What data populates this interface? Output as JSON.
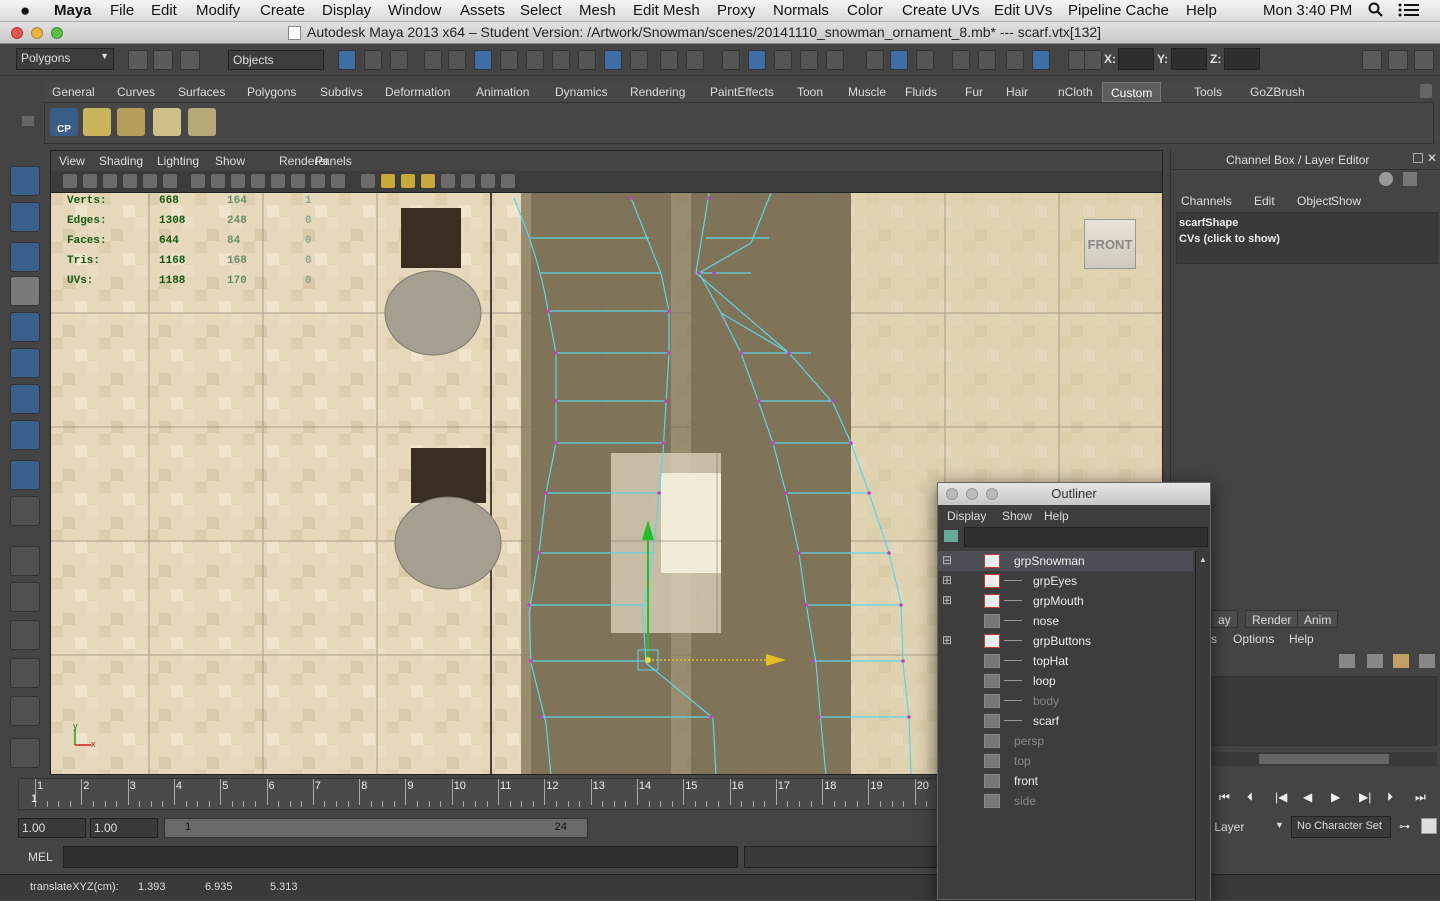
{
  "menubar": {
    "app": "Maya",
    "items": [
      "File",
      "Edit",
      "Modify",
      "Create",
      "Display",
      "Window",
      "Assets",
      "Select",
      "Mesh",
      "Edit Mesh",
      "Proxy",
      "Normals",
      "Color",
      "Create UVs",
      "Edit UVs",
      "Pipeline Cache",
      "Help"
    ],
    "clock": "Mon 3:40 PM"
  },
  "window": {
    "title": "Autodesk Maya 2013 x64 – Student Version: /Artwork/Snowman/scenes/20141110_snowman_ornament_8.mb*   ---   scarf.vtx[132]"
  },
  "statusline": {
    "mode": "Polygons",
    "selection_mode": "Objects",
    "x_label": "X:",
    "y_label": "Y:",
    "z_label": "Z:"
  },
  "shelf_tabs": [
    "General",
    "Curves",
    "Surfaces",
    "Polygons",
    "Subdivs",
    "Deformation",
    "Animation",
    "Dynamics",
    "Rendering",
    "PaintEffects",
    "Toon",
    "Muscle",
    "Fluids",
    "Fur",
    "Hair",
    "nCloth",
    "Custom",
    "Tools",
    "GoZBrush"
  ],
  "active_shelf_tab": "Custom",
  "shelf_icon_label": "CP",
  "viewport": {
    "menu": [
      "View",
      "Shading",
      "Lighting",
      "Show",
      "Renderer",
      "Panels"
    ],
    "camera_label": "FRONT",
    "hud": [
      {
        "label": "Verts:",
        "a": "668",
        "b": "164",
        "c": "1"
      },
      {
        "label": "Edges:",
        "a": "1308",
        "b": "248",
        "c": "0"
      },
      {
        "label": "Faces:",
        "a": "644",
        "b": "84",
        "c": "0"
      },
      {
        "label": "Tris:",
        "a": "1168",
        "b": "168",
        "c": "0"
      },
      {
        "label": "UVs:",
        "a": "1188",
        "b": "170",
        "c": "0"
      }
    ],
    "axis_y": "y",
    "axis_x": "x"
  },
  "timeline": {
    "frames": [
      "1",
      "2",
      "3",
      "4",
      "5",
      "6",
      "7",
      "8",
      "9",
      "10",
      "11",
      "12",
      "13",
      "14",
      "15",
      "16",
      "17",
      "18",
      "19",
      "20"
    ],
    "current_frame": "1"
  },
  "range": {
    "start": "1.00",
    "playback_start": "1.00",
    "slider_start": "1",
    "slider_end": "24"
  },
  "mel": {
    "label": "MEL"
  },
  "status": {
    "label": "translateXYZ(cm):",
    "x": "1.393",
    "y": "6.935",
    "z": "5.313"
  },
  "channel_box": {
    "title": "Channel Box / Layer Editor",
    "menu": [
      "Channels",
      "Edit",
      "Object",
      "Show"
    ],
    "shape_name": "scarfShape",
    "cvs_hint": "CVs (click to show)",
    "layer_tabs": [
      "ay",
      "Render",
      "Anim"
    ],
    "layer_menu": [
      "s",
      "Options",
      "Help"
    ],
    "anim_layer": "m Layer",
    "character_set": "No Character Set"
  },
  "outliner": {
    "title": "Outliner",
    "menu": [
      "Display",
      "Show",
      "Help"
    ],
    "items": [
      {
        "name": "grpSnowman",
        "depth": 0,
        "expand": "⊟",
        "selected": true,
        "dim": false,
        "icon": "group"
      },
      {
        "name": "grpEyes",
        "depth": 1,
        "expand": "⊞",
        "selected": false,
        "dim": false,
        "icon": "group"
      },
      {
        "name": "grpMouth",
        "depth": 1,
        "expand": "⊞",
        "selected": false,
        "dim": false,
        "icon": "group"
      },
      {
        "name": "nose",
        "depth": 1,
        "expand": "",
        "selected": false,
        "dim": false,
        "icon": "mesh"
      },
      {
        "name": "grpButtons",
        "depth": 1,
        "expand": "⊞",
        "selected": false,
        "dim": false,
        "icon": "group"
      },
      {
        "name": "topHat",
        "depth": 1,
        "expand": "",
        "selected": false,
        "dim": false,
        "icon": "mesh"
      },
      {
        "name": "loop",
        "depth": 1,
        "expand": "",
        "selected": false,
        "dim": false,
        "icon": "mesh"
      },
      {
        "name": "body",
        "depth": 1,
        "expand": "",
        "selected": false,
        "dim": true,
        "icon": "mesh"
      },
      {
        "name": "scarf",
        "depth": 1,
        "expand": "",
        "selected": false,
        "dim": false,
        "icon": "mesh"
      },
      {
        "name": "persp",
        "depth": 0,
        "expand": "",
        "selected": false,
        "dim": true,
        "icon": "camera"
      },
      {
        "name": "top",
        "depth": 0,
        "expand": "",
        "selected": false,
        "dim": true,
        "icon": "camera"
      },
      {
        "name": "front",
        "depth": 0,
        "expand": "",
        "selected": false,
        "dim": false,
        "icon": "camera"
      },
      {
        "name": "side",
        "depth": 0,
        "expand": "",
        "selected": false,
        "dim": true,
        "icon": "camera"
      }
    ]
  },
  "colors": {
    "accent": "#5a7fa8",
    "wire": "#5fd3e6",
    "vertex": "#c040c0",
    "manip_y": "#22c022",
    "manip_x": "#e0c020",
    "hud_green": "#145a14"
  }
}
